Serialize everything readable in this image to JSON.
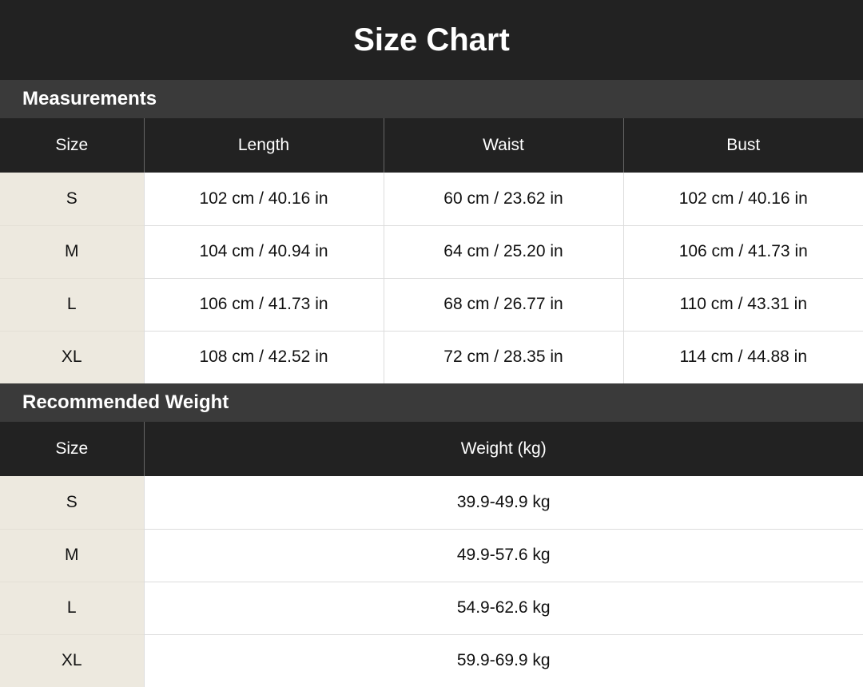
{
  "title": "Size Chart",
  "measurements": {
    "heading": "Measurements",
    "columns": [
      "Size",
      "Length",
      "Waist",
      "Bust"
    ],
    "rows": [
      {
        "size": "S",
        "length": "102 cm / 40.16 in",
        "waist": "60 cm / 23.62 in",
        "bust": "102 cm / 40.16 in"
      },
      {
        "size": "M",
        "length": "104 cm / 40.94 in",
        "waist": "64 cm / 25.20 in",
        "bust": "106 cm / 41.73 in"
      },
      {
        "size": "L",
        "length": "106 cm / 41.73 in",
        "waist": "68 cm / 26.77 in",
        "bust": "110 cm / 43.31 in"
      },
      {
        "size": "XL",
        "length": "108 cm / 42.52 in",
        "waist": "72 cm / 28.35 in",
        "bust": "114 cm / 44.88 in"
      }
    ]
  },
  "weight": {
    "heading": "Recommended Weight",
    "columns": [
      "Size",
      "Weight (kg)"
    ],
    "rows": [
      {
        "size": "S",
        "weight": "39.9-49.9 kg"
      },
      {
        "size": "M",
        "weight": "49.9-57.6 kg"
      },
      {
        "size": "L",
        "weight": "54.9-62.6 kg"
      },
      {
        "size": "XL",
        "weight": "59.9-69.9 kg"
      }
    ]
  }
}
